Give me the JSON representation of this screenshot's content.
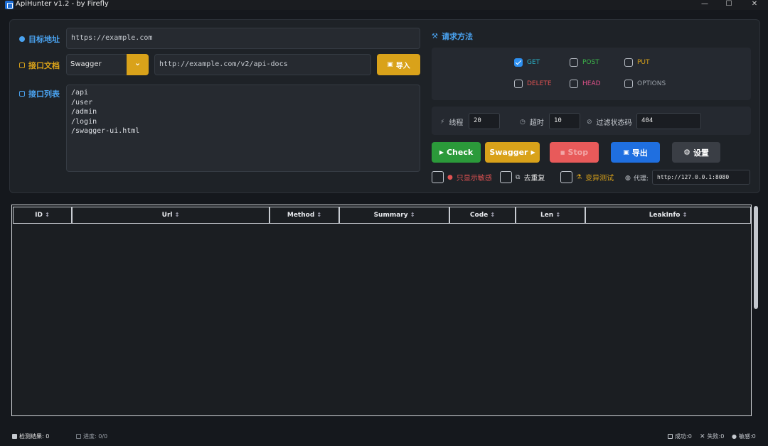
{
  "window": {
    "title": "ApiHunter v1.2 - by Firefly",
    "minimize": "—",
    "maximize": "☐",
    "close": "✕"
  },
  "config": {
    "target_label": "目标地址",
    "target_value": "https://example.com",
    "doc_label": "接口文档",
    "doc_type": "Swagger",
    "doc_url": "http://example.com/v2/api-docs",
    "import_label": "导入",
    "list_label": "接口列表",
    "list_items": [
      "/api",
      "/user",
      "/admin",
      "/login",
      "/swagger-ui.html"
    ]
  },
  "methods": {
    "title": "请求方法",
    "items": [
      {
        "label": "GET",
        "checked": true,
        "color": "#2ab3c9"
      },
      {
        "label": "POST",
        "checked": false,
        "color": "#3cb54a"
      },
      {
        "label": "PUT",
        "checked": false,
        "color": "#d9a21a"
      },
      {
        "label": "DELETE",
        "checked": false,
        "color": "#e05252"
      },
      {
        "label": "HEAD",
        "checked": false,
        "color": "#e0518a"
      },
      {
        "label": "OPTIONS",
        "checked": false,
        "color": "#9aa0a8"
      }
    ]
  },
  "params": {
    "threads_label": "线程",
    "threads_value": "20",
    "timeout_label": "超时",
    "timeout_value": "10",
    "filter_label": "过滤状态码",
    "filter_value": "404"
  },
  "actions": {
    "check": "Check",
    "swagger": "Swagger",
    "stop": "Stop",
    "export": "导出",
    "settings": "设置"
  },
  "options": {
    "sensitive_only": "只显示敏感",
    "dedupe": "去重复",
    "mutation": "变异测试",
    "proxy_label": "代理:",
    "proxy_value": "http://127.0.0.1:8080"
  },
  "table": {
    "columns": [
      "ID",
      "Url",
      "Method",
      "Summary",
      "Code",
      "Len",
      "LeakInfo"
    ],
    "sort_glyph": "↕"
  },
  "status": {
    "result_label": "检测结果: 0",
    "progress_label": "进度: 0/0",
    "success_label": "成功:0",
    "fail_label": "失败:0",
    "sensitive_label": "敏感:0"
  },
  "colors": {
    "accent_blue": "#3d8ff0",
    "accent_gold": "#d9a21a",
    "check_green": "#2b9a3a",
    "stop_red": "#e85a5a",
    "export_blue": "#1f6fe0"
  }
}
